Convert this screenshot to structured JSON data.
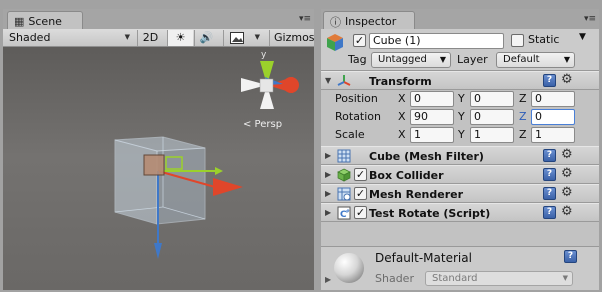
{
  "scene": {
    "tab_label": "Scene",
    "tab_icon": "scene-grid-icon",
    "toolbar": {
      "draw_mode": "Shaded",
      "toggle_2d": "2D",
      "lighting_icon": "sun-icon",
      "audio_icon": "speaker-icon",
      "effects_icon": "image-icon",
      "gizmos_label": "Gizmos"
    },
    "persp_label": "< Persp"
  },
  "inspector": {
    "tab_label": "Inspector",
    "tab_icon": "info-icon",
    "object": {
      "active": true,
      "name": "Cube (1)",
      "static_label": "Static",
      "static_checked": false,
      "tag_label": "Tag",
      "tag_value": "Untagged",
      "layer_label": "Layer",
      "layer_value": "Default"
    },
    "transform": {
      "title": "Transform",
      "rows": [
        {
          "label": "Position",
          "x": "0",
          "y": "0",
          "z": "0"
        },
        {
          "label": "Rotation",
          "x": "90",
          "y": "0",
          "z": "0"
        },
        {
          "label": "Scale",
          "x": "1",
          "y": "1",
          "z": "1"
        }
      ],
      "axis_x": "X",
      "axis_y": "Y",
      "axis_z": "Z"
    },
    "components": [
      {
        "title": "Cube (Mesh Filter)",
        "has_checkbox": false,
        "enabled": true
      },
      {
        "title": "Box Collider",
        "has_checkbox": true,
        "enabled": true
      },
      {
        "title": "Mesh Renderer",
        "has_checkbox": true,
        "enabled": true
      },
      {
        "title": "Test Rotate (Script)",
        "has_checkbox": true,
        "enabled": true
      }
    ],
    "material": {
      "name": "Default-Material",
      "shader_label": "Shader",
      "shader_value": "Standard"
    }
  },
  "colors": {
    "viewport_bg": "#6f6d6b",
    "panel_bg": "#c2c2c2",
    "axis_x": "#e0462a",
    "axis_y": "#9bd12b",
    "axis_z": "#3f78c8",
    "focus_blue": "#4a7fd6"
  }
}
